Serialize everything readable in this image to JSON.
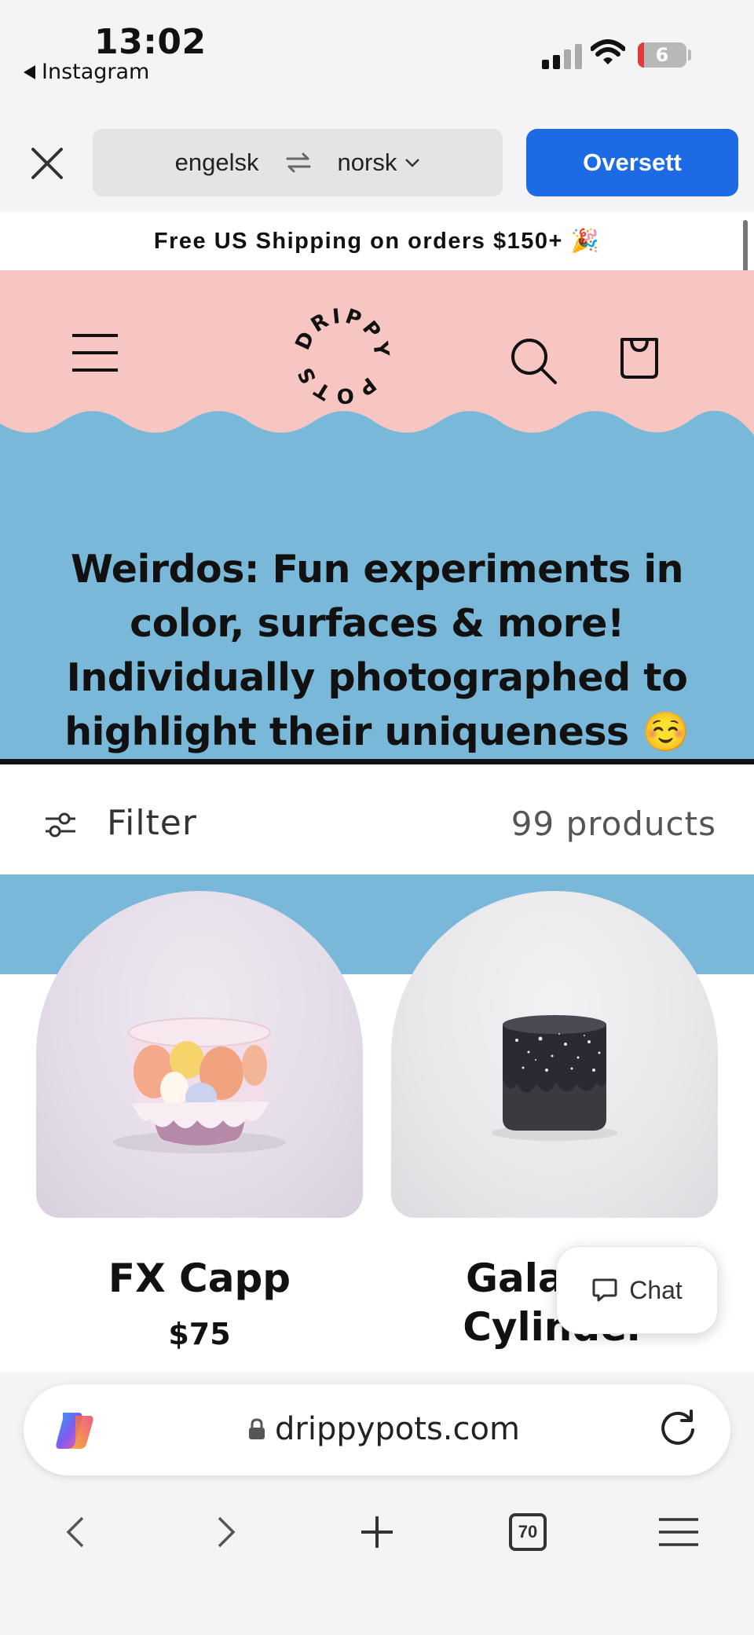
{
  "status_bar": {
    "time": "13:02",
    "back_app": "Instagram",
    "battery": "6"
  },
  "translate": {
    "from": "engelsk",
    "to": "norsk",
    "button": "Oversett"
  },
  "site": {
    "announcement": "Free US Shipping on orders $150+ 🎉",
    "logo_text": "DRIPPY POTS",
    "hero_title": "Weirdos: Fun experiments in color, surfaces & more! Individually photographed to highlight their uniqueness ☺️",
    "filter_label": "Filter",
    "product_count": "99 products",
    "products": [
      {
        "name": "FX Capp",
        "price": "$75"
      },
      {
        "name": "Galactic Cylinder",
        "price": ""
      }
    ],
    "chat_label": "Chat"
  },
  "browser": {
    "url": "drippypots.com",
    "tab_count": "70"
  },
  "colors": {
    "header_pink": "#f7c6c2",
    "hero_blue": "#79b8d8",
    "translate_blue": "#1d6ae5"
  }
}
